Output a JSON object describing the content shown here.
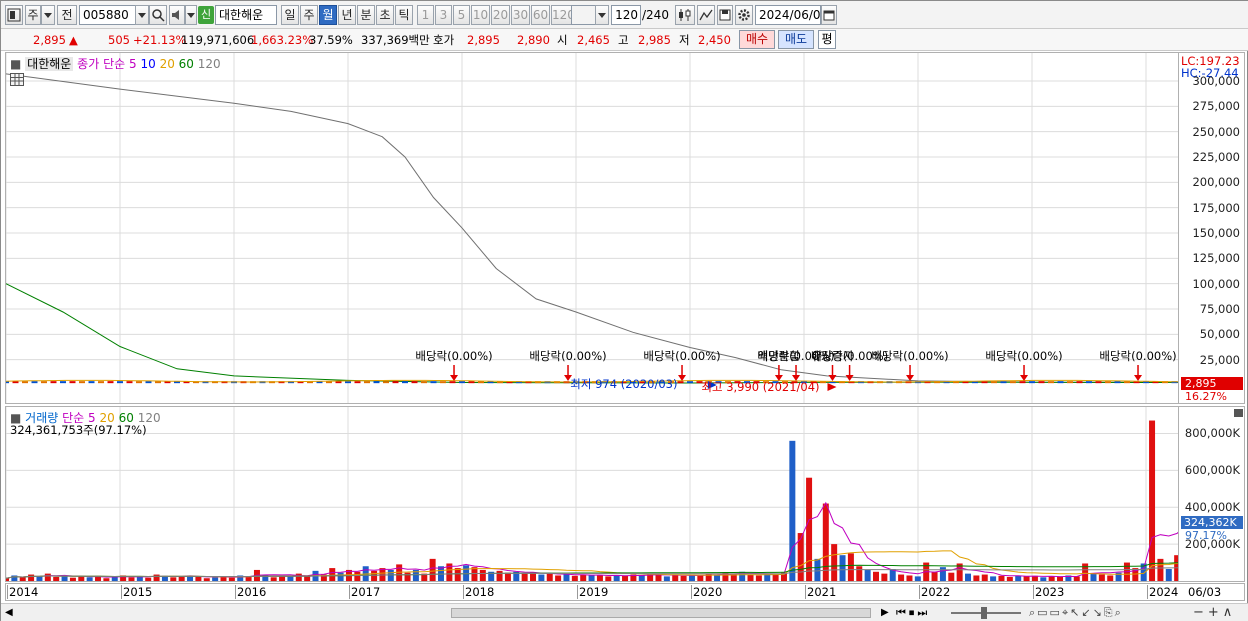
{
  "toolbar": {
    "type_label": "주",
    "prev_label": "전",
    "code": "005880",
    "new_badge": "신",
    "stock_name": "대한해운",
    "periods": [
      "일",
      "주",
      "월",
      "년",
      "분",
      "초",
      "틱"
    ],
    "selected_period": "월",
    "minute_options": [
      "1",
      "3",
      "5",
      "10",
      "20",
      "30",
      "60",
      "120"
    ],
    "count_value": "120",
    "count_total": "/240",
    "date_value": "2024/06/03"
  },
  "quote": {
    "price": "2,895",
    "change": "505",
    "change_pct": "+21.13%",
    "volume": "119,971,606",
    "vol_pct": "1,663.23%",
    "turnover_pct": "37.59%",
    "amount": "337,369백만",
    "ask_label": "호가",
    "ask": "2,895",
    "bid": "2,890",
    "open_label": "시",
    "open": "2,465",
    "high_label": "고",
    "high": "2,985",
    "low_label": "저",
    "low": "2,450",
    "buy_label": "매수",
    "sell_label": "매도",
    "eval_label": "평"
  },
  "price_pane": {
    "legend_name": "대한해운",
    "legend_ma_label": "종가 단순",
    "ma_periods": [
      "5",
      "10",
      "20",
      "60",
      "120"
    ],
    "ma_colors": [
      "#c000c0",
      "#0000ff",
      "#e0a000",
      "#008000",
      "#808080"
    ],
    "lc": "LC:197.23",
    "hc": "HC:-27.44",
    "y_ticks": [
      "300,000",
      "275,000",
      "250,000",
      "225,000",
      "200,000",
      "175,000",
      "150,000",
      "125,000",
      "100,000",
      "75,000",
      "50,000",
      "25,000"
    ],
    "current_price_label": "2,895",
    "current_pct_label": "16.27%",
    "low_note": "최저 974 (2020/03)",
    "high_note": "최고 3,990 (2021/04)",
    "events": [
      {
        "label": "배당락(0.00%)",
        "year": 2017.93
      },
      {
        "label": "배당락(0.00%)",
        "year": 2018.93
      },
      {
        "label": "배당락(0.00%)",
        "year": 2019.93
      },
      {
        "label": "액면분할",
        "year": 2020.78
      },
      {
        "label": "배당락(0.00%)",
        "year": 2020.93
      },
      {
        "label": "유상증자",
        "year": 2021.25
      },
      {
        "label": "배당락(0.00%)",
        "year": 2021.4
      },
      {
        "label": "배당락(0.00%)",
        "year": 2021.93
      },
      {
        "label": "배당락(0.00%)",
        "year": 2022.93
      },
      {
        "label": "배당락(0.00%)",
        "year": 2023.93
      }
    ]
  },
  "volume_pane": {
    "legend_name": "거래량",
    "legend_ma_label": "단순",
    "ma_periods": [
      "5",
      "20",
      "60",
      "120"
    ],
    "ma_colors": [
      "#c000c0",
      "#e0a000",
      "#008000",
      "#808080"
    ],
    "volume_readout": "324,361,753주(97.17%)",
    "y_ticks": [
      "800,000K",
      "600,000K",
      "400,000K",
      "200,000K"
    ],
    "current_label": "324,362K",
    "current_pct_label": "97.17%"
  },
  "x_axis": {
    "years": [
      "2014",
      "2015",
      "2016",
      "2017",
      "2018",
      "2019",
      "2020",
      "2021",
      "2022",
      "2023",
      "2024"
    ],
    "end_label": "06/03"
  },
  "chart_data": {
    "type": "line",
    "x_unit": "year",
    "series": [
      {
        "name": "120",
        "pane": "price",
        "points": [
          [
            2014.0,
            307000
          ],
          [
            2015.0,
            292000
          ],
          [
            2016.0,
            278000
          ],
          [
            2016.5,
            270000
          ],
          [
            2017.0,
            258000
          ],
          [
            2017.3,
            245000
          ],
          [
            2017.5,
            225000
          ],
          [
            2017.75,
            185000
          ],
          [
            2018.0,
            155000
          ],
          [
            2018.3,
            115000
          ],
          [
            2018.65,
            85000
          ],
          [
            2019.0,
            72000
          ],
          [
            2019.5,
            52000
          ],
          [
            2020.0,
            37000
          ],
          [
            2020.4,
            27000
          ],
          [
            2020.8,
            15000
          ],
          [
            2021.2,
            9000
          ],
          [
            2022.0,
            4000
          ],
          [
            2023.0,
            2800
          ],
          [
            2024.4,
            2700
          ]
        ]
      },
      {
        "name": "60",
        "pane": "price",
        "points": [
          [
            2014.0,
            100000
          ],
          [
            2014.5,
            72000
          ],
          [
            2015.0,
            38000
          ],
          [
            2015.5,
            16000
          ],
          [
            2016.0,
            9000
          ],
          [
            2017.0,
            4500
          ],
          [
            2018.0,
            2500
          ],
          [
            2020.0,
            2000
          ],
          [
            2021.0,
            2600
          ],
          [
            2022.0,
            2800
          ],
          [
            2024.4,
            2500
          ]
        ]
      }
    ],
    "volume_bars_k": [
      15,
      30,
      20,
      35,
      25,
      40,
      22,
      30,
      18,
      25,
      20,
      28,
      15,
      22,
      30,
      20,
      25,
      18,
      35,
      28,
      20,
      25,
      30,
      22,
      15,
      20,
      25,
      18,
      30,
      22,
      60,
      35,
      20,
      28,
      25,
      40,
      30,
      55,
      35,
      70,
      45,
      60,
      50,
      80,
      55,
      70,
      60,
      90,
      45,
      60,
      40,
      120,
      80,
      95,
      70,
      85,
      75,
      60,
      50,
      55,
      45,
      50,
      40,
      45,
      35,
      40,
      30,
      38,
      28,
      35,
      30,
      32,
      25,
      30,
      28,
      35,
      30,
      40,
      35,
      25,
      30,
      28,
      35,
      30,
      40,
      35,
      45,
      40,
      50,
      35,
      30,
      40,
      35,
      45,
      760,
      260,
      560,
      120,
      420,
      200,
      140,
      150,
      80,
      60,
      50,
      40,
      65,
      35,
      30,
      25,
      100,
      50,
      75,
      45,
      95,
      40,
      30,
      35,
      25,
      28,
      22,
      30,
      25,
      28,
      20,
      25,
      22,
      30,
      25,
      95,
      40,
      35,
      30,
      45,
      100,
      70,
      95,
      870,
      120,
      65,
      140,
      330,
      324
    ],
    "volume_up_bar_indexes_note": "red = up month, blue = down month",
    "y_range_price": [
      0,
      310000
    ],
    "y_range_volume_k": [
      0,
      900000
    ]
  }
}
